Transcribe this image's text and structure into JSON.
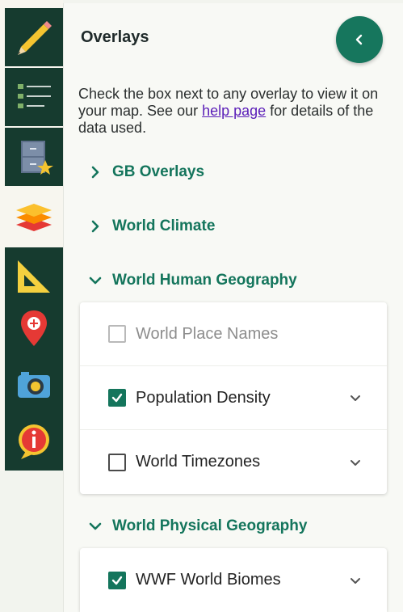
{
  "toolbar": {
    "tools": [
      {
        "name": "pencil-tool",
        "icon": "pencil-icon"
      },
      {
        "name": "legend-tool",
        "icon": "list-icon"
      },
      {
        "name": "saved-maps-tool",
        "icon": "cabinet-star-icon"
      },
      {
        "name": "overlays-tool",
        "icon": "layers-icon",
        "active": true
      },
      {
        "name": "measure-tool",
        "icon": "set-square-icon"
      },
      {
        "name": "places-tool",
        "icon": "map-pin-icon"
      },
      {
        "name": "photos-tool",
        "icon": "camera-icon"
      },
      {
        "name": "info-tool",
        "icon": "info-icon"
      }
    ]
  },
  "panel": {
    "title": "Overlays",
    "intro_text": "Check the box next to any overlay to view it on your map. See our ",
    "help_link": "help page",
    "intro_suffix": " for details of the data used."
  },
  "sections": [
    {
      "label": "GB Overlays",
      "expanded": false
    },
    {
      "label": "World Climate",
      "expanded": false
    },
    {
      "label": "World Human Geography",
      "expanded": true
    },
    {
      "label": "World Physical Geography",
      "expanded": true
    }
  ],
  "human_geography": [
    {
      "label": "World Place Names",
      "checked": false,
      "disabled": true
    },
    {
      "label": "Population Density",
      "checked": true
    },
    {
      "label": "World Timezones",
      "checked": false
    }
  ],
  "physical_geography": [
    {
      "label": "WWF World Biomes",
      "checked": true
    }
  ],
  "colors": {
    "accent": "#14755c",
    "toolbar_bg": "#163b2f",
    "link": "#5a1db8"
  }
}
